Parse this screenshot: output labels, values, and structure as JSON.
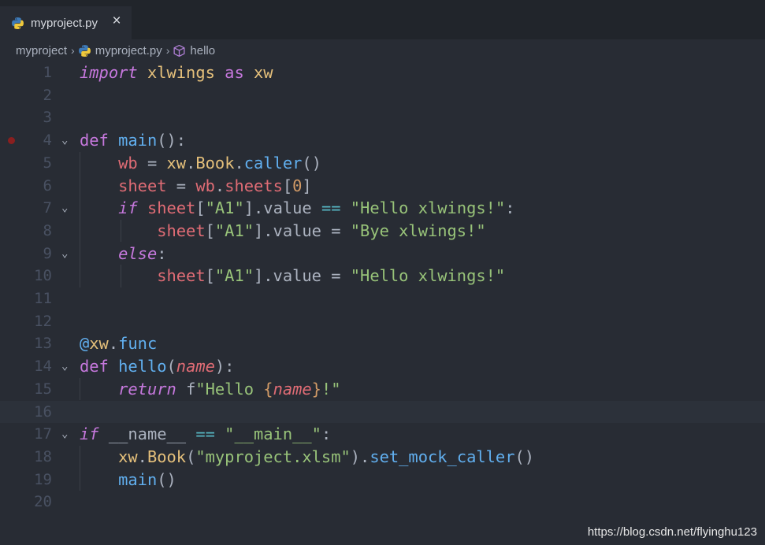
{
  "tab": {
    "label": "myproject.py",
    "close": "×",
    "icon": "python-icon"
  },
  "breadcrumb": {
    "folder": "myproject",
    "file": "myproject.py",
    "symbol": "hello",
    "separator": "›"
  },
  "colors": {
    "background": "#282c34",
    "keyword": "#c678dd",
    "function": "#61afef",
    "variable": "#e06c75",
    "string": "#98c379",
    "number": "#d19a66",
    "class": "#e5c07b"
  },
  "line_numbers": [
    "1",
    "2",
    "3",
    "4",
    "5",
    "6",
    "7",
    "8",
    "9",
    "10",
    "11",
    "12",
    "13",
    "14",
    "15",
    "16",
    "17",
    "18",
    "19",
    "20"
  ],
  "code": {
    "l1": [
      "import",
      " ",
      "xlwings",
      " ",
      "as",
      " ",
      "xw"
    ],
    "l4": [
      "def",
      " ",
      "main",
      "():"
    ],
    "l5": [
      "wb",
      " = ",
      "xw",
      ".",
      "Book",
      ".",
      "caller",
      "()"
    ],
    "l6": [
      "sheet",
      " = ",
      "wb",
      ".",
      "sheets",
      "[",
      "0",
      "]"
    ],
    "l7": [
      "if",
      " ",
      "sheet",
      "[",
      "\"A1\"",
      "].value ",
      "==",
      " ",
      "\"Hello xlwings!\"",
      ":"
    ],
    "l8": [
      "sheet",
      "[",
      "\"A1\"",
      "].value = ",
      "\"Bye xlwings!\""
    ],
    "l9": [
      "else",
      ":"
    ],
    "l10": [
      "sheet",
      "[",
      "\"A1\"",
      "].value = ",
      "\"Hello xlwings!\""
    ],
    "l13": [
      "@",
      "xw",
      ".",
      "func"
    ],
    "l14": [
      "def",
      " ",
      "hello",
      "(",
      "name",
      "):"
    ],
    "l15": [
      "return",
      " ",
      "f",
      "\"Hello ",
      "{",
      "name",
      "}",
      "!\""
    ],
    "l17": [
      "if",
      " __name__ ",
      "==",
      " ",
      "\"__main__\"",
      ":"
    ],
    "l18": [
      "xw",
      ".",
      "Book",
      "(",
      "\"myproject.xlsm\"",
      ").",
      "set_mock_caller",
      "()"
    ],
    "l19": [
      "main",
      "()"
    ]
  },
  "watermark": "https://blog.csdn.net/flyinghu123"
}
